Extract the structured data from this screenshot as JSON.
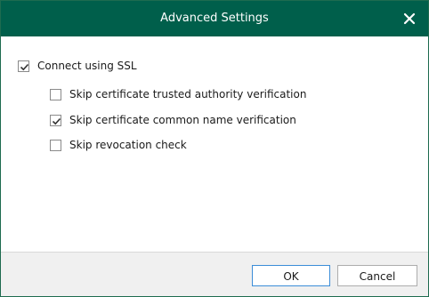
{
  "window": {
    "title": "Advanced Settings",
    "close_icon": "close-icon"
  },
  "options": {
    "ssl": {
      "label": "Connect using SSL",
      "checked": true
    },
    "skip_trusted_authority": {
      "label": "Skip certificate trusted authority verification",
      "checked": false
    },
    "skip_common_name": {
      "label": "Skip certificate common name verification",
      "checked": true
    },
    "skip_revocation": {
      "label": "Skip revocation check",
      "checked": false
    }
  },
  "buttons": {
    "ok_label": "OK",
    "cancel_label": "Cancel"
  },
  "colors": {
    "titlebar": "#005f4b",
    "footer": "#f0f0f0",
    "primary_border": "#3c8dd8"
  }
}
